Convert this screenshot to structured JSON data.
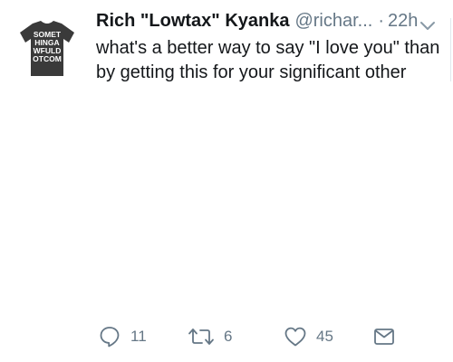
{
  "tweet": {
    "avatar_shirt_text": [
      "SOMET",
      "HINGA",
      "WFULD",
      "OTCOM"
    ],
    "display_name": "Rich \"Lowtax\" Kyanka",
    "handle": "@richar...",
    "separator": "·",
    "time": "22h",
    "text": "what's a better way to say \"I love you\" than by getting this for your significant other",
    "actions": {
      "reply_count": "11",
      "retweet_count": "6",
      "like_count": "45"
    }
  },
  "colors": {
    "text": "#14171a",
    "secondary": "#657786",
    "shirt": "#3a3a3a"
  },
  "icons": {
    "caret": "chevron-down-icon",
    "reply": "reply-icon",
    "retweet": "retweet-icon",
    "like": "heart-icon",
    "dm": "envelope-icon"
  }
}
